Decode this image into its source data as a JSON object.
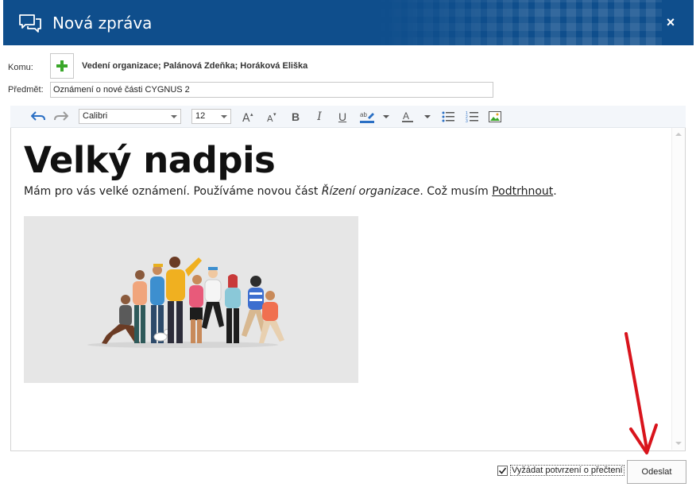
{
  "window": {
    "title": "Nová zpráva",
    "close_glyph": "×"
  },
  "form": {
    "to_label": "Komu:",
    "recipients": "Vedení organizace; Palánová Zdeňka; Horáková Eliška",
    "subject_label": "Předmět:",
    "subject_value": "Oznámení o nové části CYGNUS 2"
  },
  "toolbar": {
    "font_name": "Calibri",
    "font_size": "12",
    "buttons": [
      "undo-icon",
      "redo-icon",
      "grow-font-icon",
      "shrink-font-icon",
      "bold-icon",
      "italic-icon",
      "underline-icon",
      "highlight-icon",
      "font-color-icon",
      "bullet-list-icon",
      "numbered-list-icon",
      "insert-image-icon"
    ]
  },
  "editor": {
    "heading": "Velký nadpis",
    "para_part1": "Mám pro vás velké oznámení. Používáme novou část ",
    "para_italic": "Řízení organizace",
    "para_part2": ". Což musím ",
    "para_underline": "Podtrhnout",
    "para_end": "."
  },
  "footer": {
    "read_receipt_label": "Vyžádat potvrzení o přečtení",
    "read_receipt_checked": true,
    "send_label": "Odeslat"
  },
  "colors": {
    "titlebar": "#0f4e8c",
    "accent_green": "#3aa72a",
    "annotation_arrow": "#d9141c"
  }
}
